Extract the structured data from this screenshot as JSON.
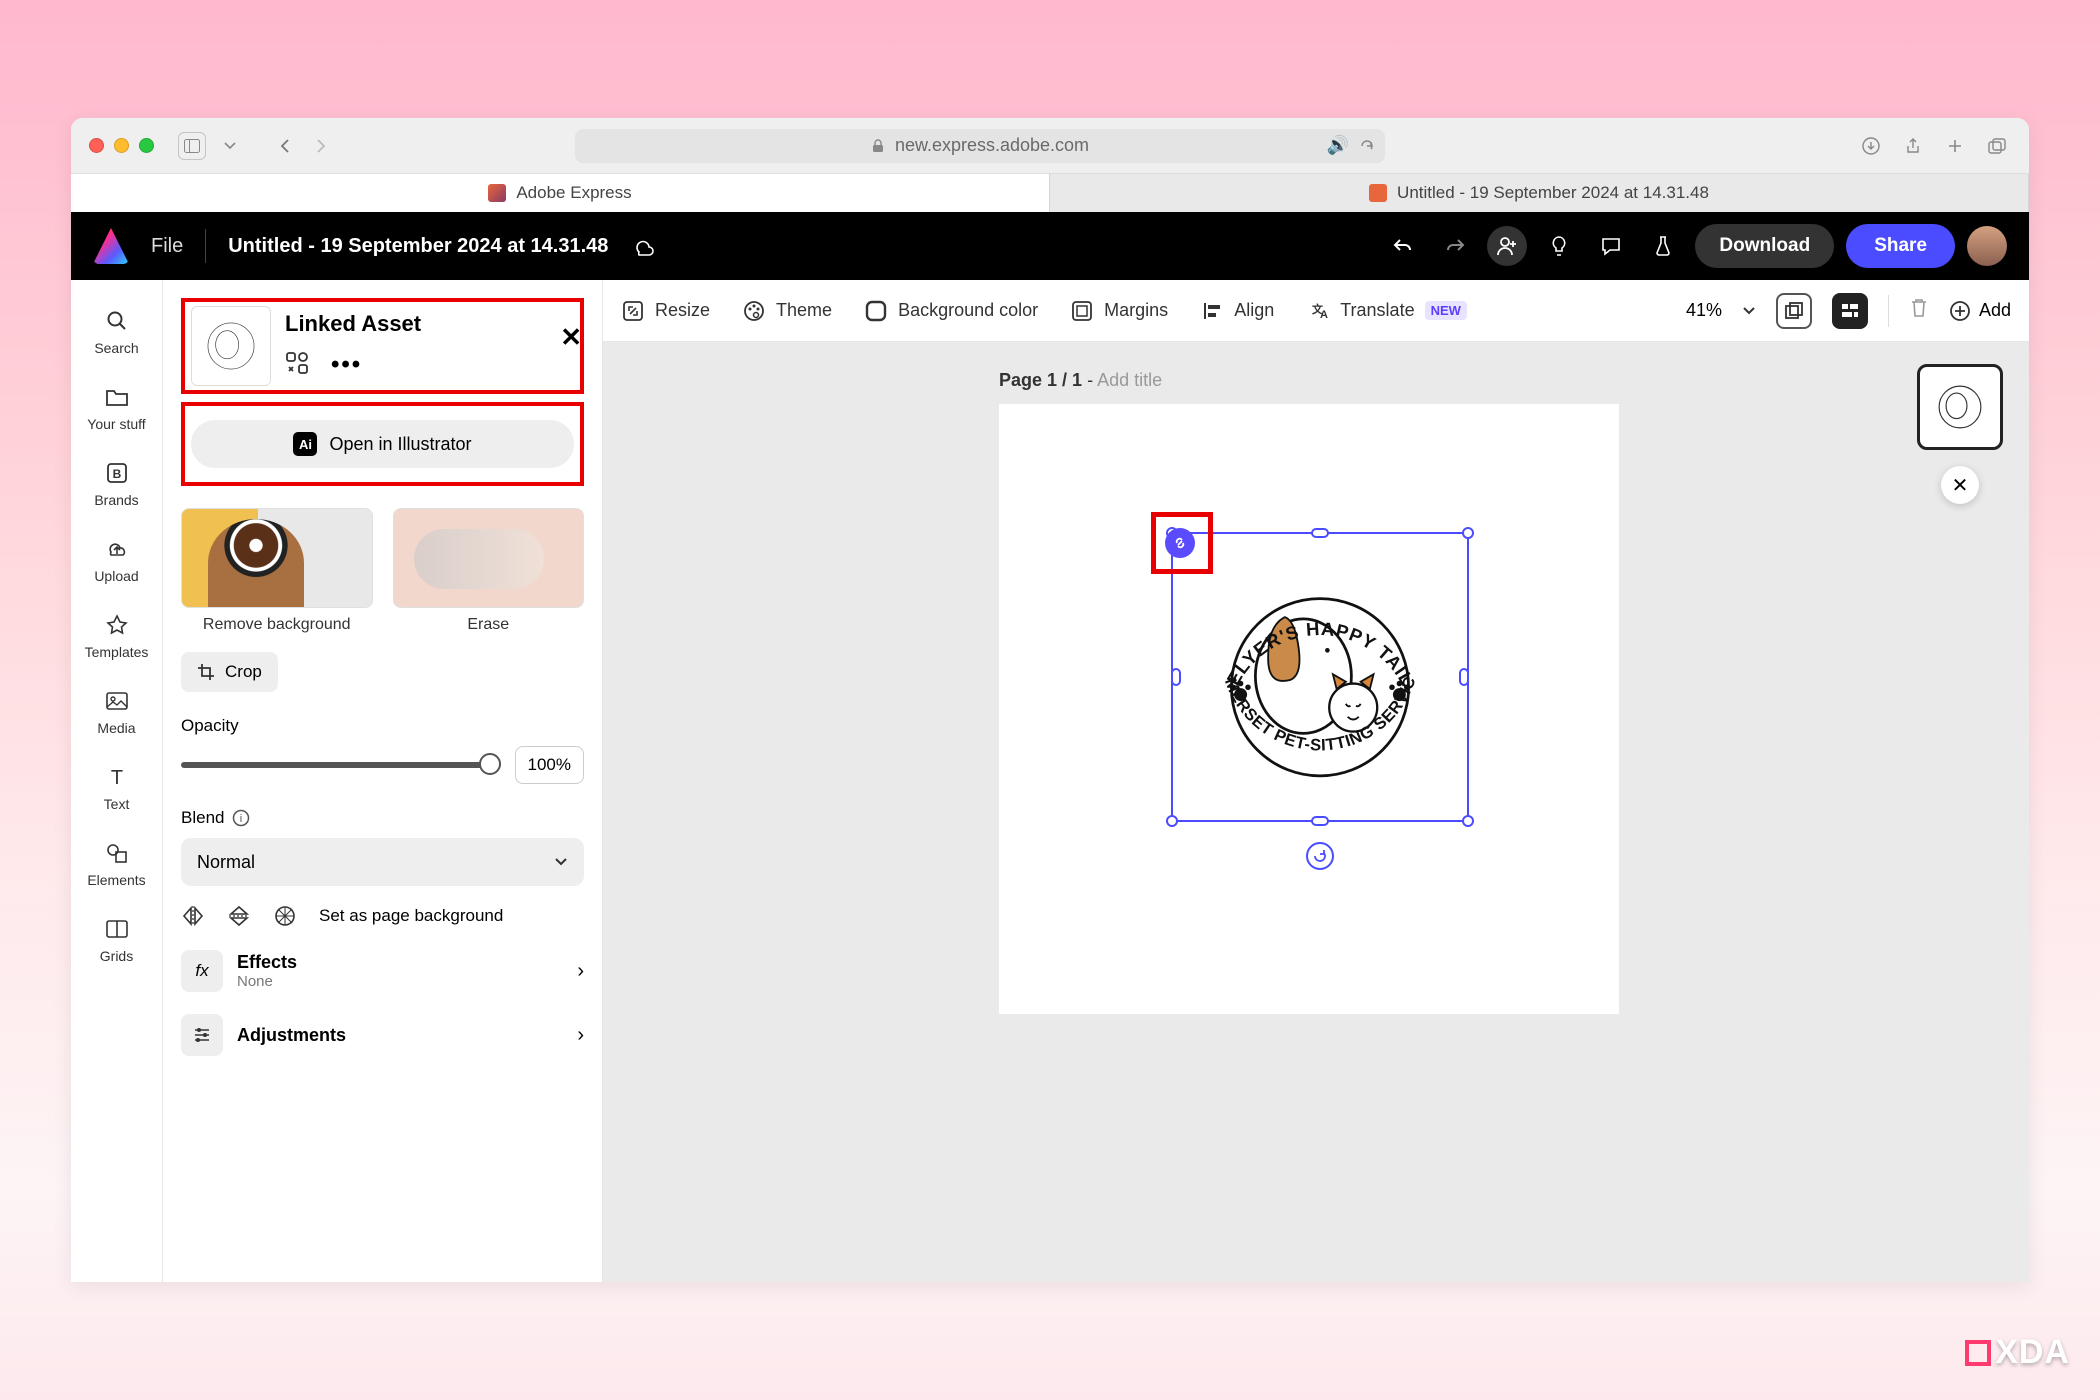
{
  "browser": {
    "url": "new.express.adobe.com",
    "tabs": [
      {
        "label": "Adobe Express"
      },
      {
        "label": "Untitled - 19 September 2024 at 14.31.48"
      }
    ]
  },
  "header": {
    "file": "File",
    "title": "Untitled - 19 September 2024 at 14.31.48",
    "download": "Download",
    "share": "Share"
  },
  "rail": {
    "search": "Search",
    "your_stuff": "Your stuff",
    "brands": "Brands",
    "upload": "Upload",
    "templates": "Templates",
    "media": "Media",
    "text": "Text",
    "elements": "Elements",
    "grids": "Grids"
  },
  "panel": {
    "title": "Linked Asset",
    "open_in_ai": "Open in Illustrator",
    "remove_bg": "Remove background",
    "erase": "Erase",
    "crop": "Crop",
    "opacity_label": "Opacity",
    "opacity_value": "100%",
    "blend_label": "Blend",
    "blend_value": "Normal",
    "set_bg": "Set as page background",
    "effects_title": "Effects",
    "effects_sub": "None",
    "adjustments_title": "Adjustments"
  },
  "toolbar": {
    "resize": "Resize",
    "theme": "Theme",
    "bg_color": "Background color",
    "margins": "Margins",
    "align": "Align",
    "translate": "Translate",
    "new_badge": "NEW",
    "zoom": "41%",
    "add": "Add"
  },
  "stage": {
    "page_indicator": "Page 1 / 1",
    "page_dash": " - ",
    "add_title_placeholder": "Add title"
  },
  "artwork": {
    "top_text": "HELYER'S HAPPY TAILS",
    "bottom_text": "SOMERSET PET-SITTING SERVICES"
  },
  "watermark": "XDA"
}
